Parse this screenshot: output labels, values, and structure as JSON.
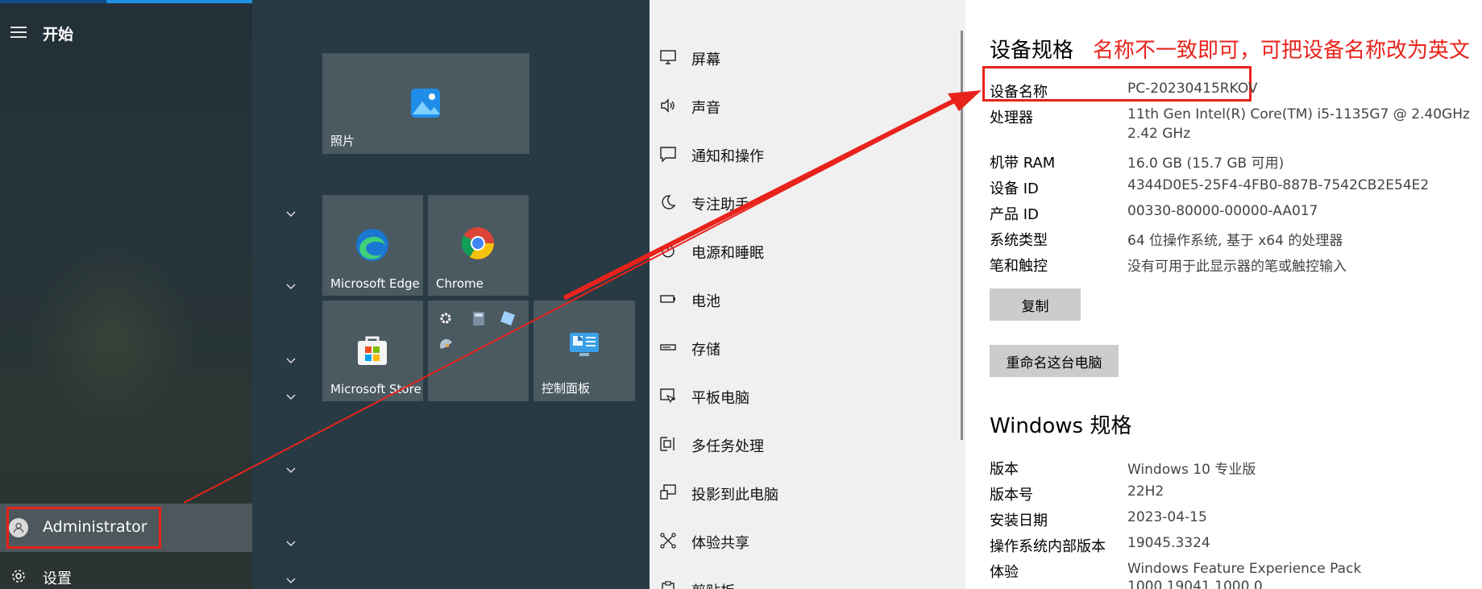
{
  "start_menu": {
    "title": "开始",
    "user": "Administrator",
    "settings": "设置"
  },
  "tiles": [
    {
      "label": "照片",
      "icon": "photos-icon"
    },
    {
      "label": "Microsoft Edge",
      "icon": "edge-icon"
    },
    {
      "label": "Chrome",
      "icon": "chrome-icon"
    },
    {
      "label": "Microsoft Store",
      "icon": "store-icon"
    },
    {
      "label": "",
      "icon": "settings-calculator-group-icon"
    },
    {
      "label": "控制面板",
      "icon": "control-panel-icon"
    }
  ],
  "settings_nav": {
    "items": [
      {
        "label": "屏幕",
        "icon": "monitor-icon"
      },
      {
        "label": "声音",
        "icon": "speaker-icon"
      },
      {
        "label": "通知和操作",
        "icon": "notification-icon"
      },
      {
        "label": "专注助手",
        "icon": "moon-icon"
      },
      {
        "label": "电源和睡眠",
        "icon": "power-icon"
      },
      {
        "label": "电池",
        "icon": "battery-icon"
      },
      {
        "label": "存储",
        "icon": "storage-icon"
      },
      {
        "label": "平板电脑",
        "icon": "tablet-icon"
      },
      {
        "label": "多任务处理",
        "icon": "multitask-icon"
      },
      {
        "label": "投影到此电脑",
        "icon": "project-icon"
      },
      {
        "label": "体验共享",
        "icon": "share-icon"
      },
      {
        "label": "剪贴板",
        "icon": "clipboard-icon"
      }
    ]
  },
  "about": {
    "device_spec_heading": "设备规格",
    "annotation": "名称不一致即可，可把设备名称改为英文",
    "device_specs": [
      {
        "key": "设备名称",
        "value": "PC-20230415RKOV"
      },
      {
        "key": "处理器",
        "value": "11th Gen Intel(R) Core(TM) i5-1135G7 @ 2.40GHz",
        "value2": "2.42 GHz"
      },
      {
        "key": "机带 RAM",
        "value": "16.0 GB (15.7 GB 可用)"
      },
      {
        "key": "设备 ID",
        "value": "4344D0E5-25F4-4FB0-887B-7542CB2E54E2"
      },
      {
        "key": "产品 ID",
        "value": "00330-80000-00000-AA017"
      },
      {
        "key": "系统类型",
        "value": "64 位操作系统, 基于 x64 的处理器"
      },
      {
        "key": "笔和触控",
        "value": "没有可用于此显示器的笔或触控输入"
      }
    ],
    "copy_button": "复制",
    "rename_button": "重命名这台电脑",
    "windows_spec_heading": "Windows 规格",
    "windows_specs": [
      {
        "key": "版本",
        "value": "Windows 10 专业版"
      },
      {
        "key": "版本号",
        "value": "22H2"
      },
      {
        "key": "安装日期",
        "value": "2023-04-15"
      },
      {
        "key": "操作系统内部版本",
        "value": "19045.3324"
      },
      {
        "key": "体验",
        "value": "Windows Feature Experience Pack",
        "value2": "1000.19041.1000.0"
      }
    ]
  },
  "colors": {
    "annotation_red": "#e8231c",
    "accent_blue": "#1e90e6"
  }
}
